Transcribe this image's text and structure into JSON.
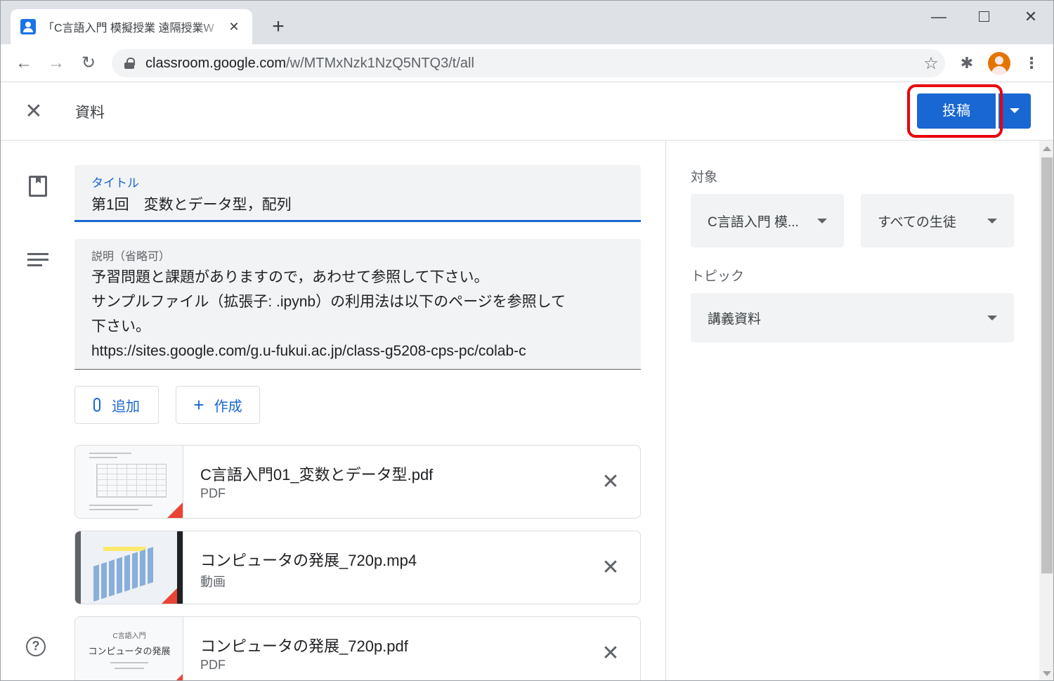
{
  "browser": {
    "tab_title": "「C言語入門 模擬授業 遠隔授業W",
    "tab_close": "✕",
    "new_tab": "+",
    "url_host": "classroom.google.com",
    "url_path": "/w/MTMxNzk1NzQ5NTQ3/t/all",
    "back": "←",
    "forward": "→",
    "reload": "↻",
    "star": "☆",
    "extensions": "✱",
    "menu": "⋮",
    "win_min": "—",
    "win_close": "✕"
  },
  "header": {
    "close": "✕",
    "title": "資料",
    "post_label": "投稿"
  },
  "form": {
    "title_label": "タイトル",
    "title_value": "第1回　変数とデータ型，配列",
    "desc_label": "説明（省略可）",
    "desc_lines": [
      "予習問題と課題がありますので，あわせて参照して下さい。",
      "サンプルファイル（拡張子: .ipynb）の利用法は以下のページを参照して",
      "下さい。",
      "https://sites.google.com/g.u-fukui.ac.jp/class-g5208-cps-pc/colab-c"
    ],
    "add_label": "追加",
    "create_label": "作成"
  },
  "attachments": [
    {
      "name": "C言語入門01_変数とデータ型.pdf",
      "type": "PDF"
    },
    {
      "name": "コンピュータの発展_720p.mp4",
      "type": "動画"
    },
    {
      "name": "コンピュータの発展_720p.pdf",
      "type": "PDF",
      "thumb_line1": "C言語入門",
      "thumb_line2": "コンピュータの発展"
    }
  ],
  "remove_glyph": "✕",
  "help_glyph": "?",
  "side": {
    "target_label": "対象",
    "class_value": "C言語入門 模...",
    "students_value": "すべての生徒",
    "topic_label": "トピック",
    "topic_value": "講義資料"
  },
  "colors": {
    "accent": "#1967d2",
    "highlight_box": "#e8000b"
  }
}
